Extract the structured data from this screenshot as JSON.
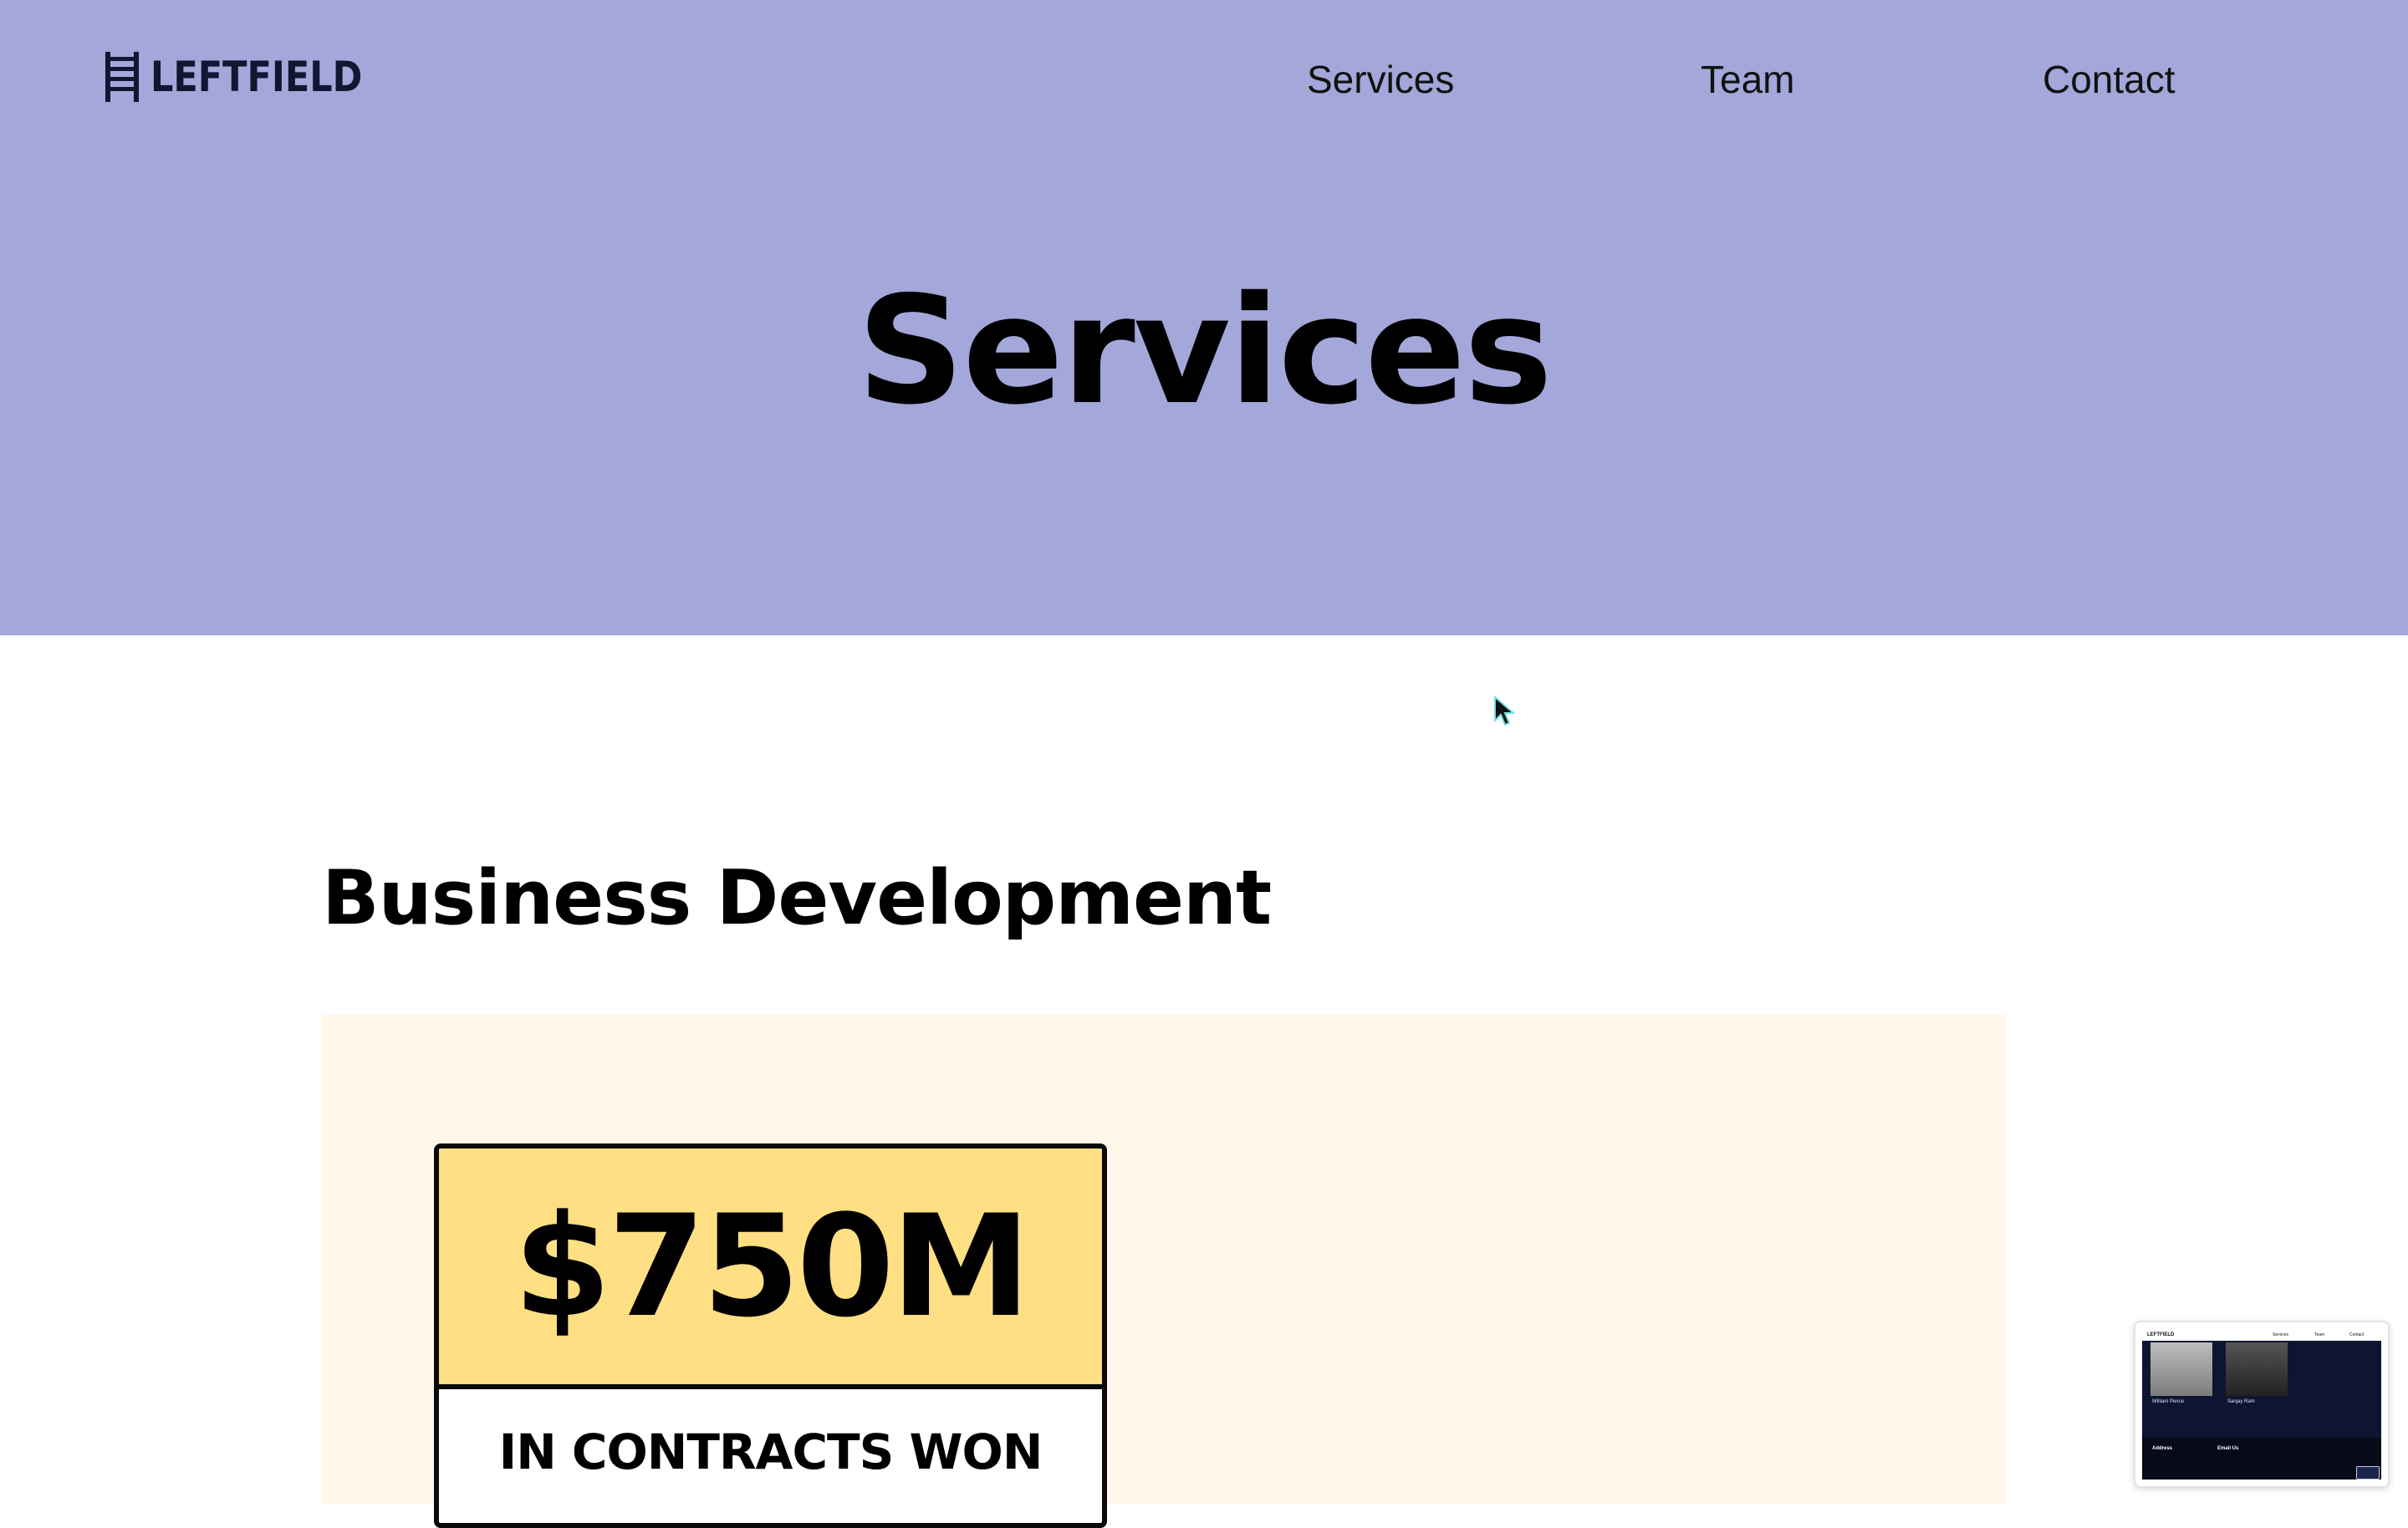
{
  "header": {
    "logo_text": "LEFTFIELD",
    "nav": [
      {
        "label": "Services"
      },
      {
        "label": "Team"
      },
      {
        "label": "Contact"
      }
    ]
  },
  "hero": {
    "title": "Services"
  },
  "section": {
    "heading": "Business Development",
    "stat": {
      "value": "$750M",
      "label": "IN CONTRACTS WON"
    }
  },
  "thumbnail": {
    "logo": "LEFTFIELD",
    "nav": [
      "Services",
      "Team",
      "Contact"
    ],
    "names": [
      "William Pierce",
      "Sanjay Ram"
    ],
    "footer_labels": [
      "Address",
      "Email Us"
    ]
  },
  "colors": {
    "hero_bg": "#a3a7da",
    "panel_bg": "#fef7ea",
    "stat_bg": "#ffdf84",
    "logo": "#101732"
  },
  "icons": {
    "logo_mark": "ladder-icon",
    "cursor": "mouse-pointer-icon"
  }
}
